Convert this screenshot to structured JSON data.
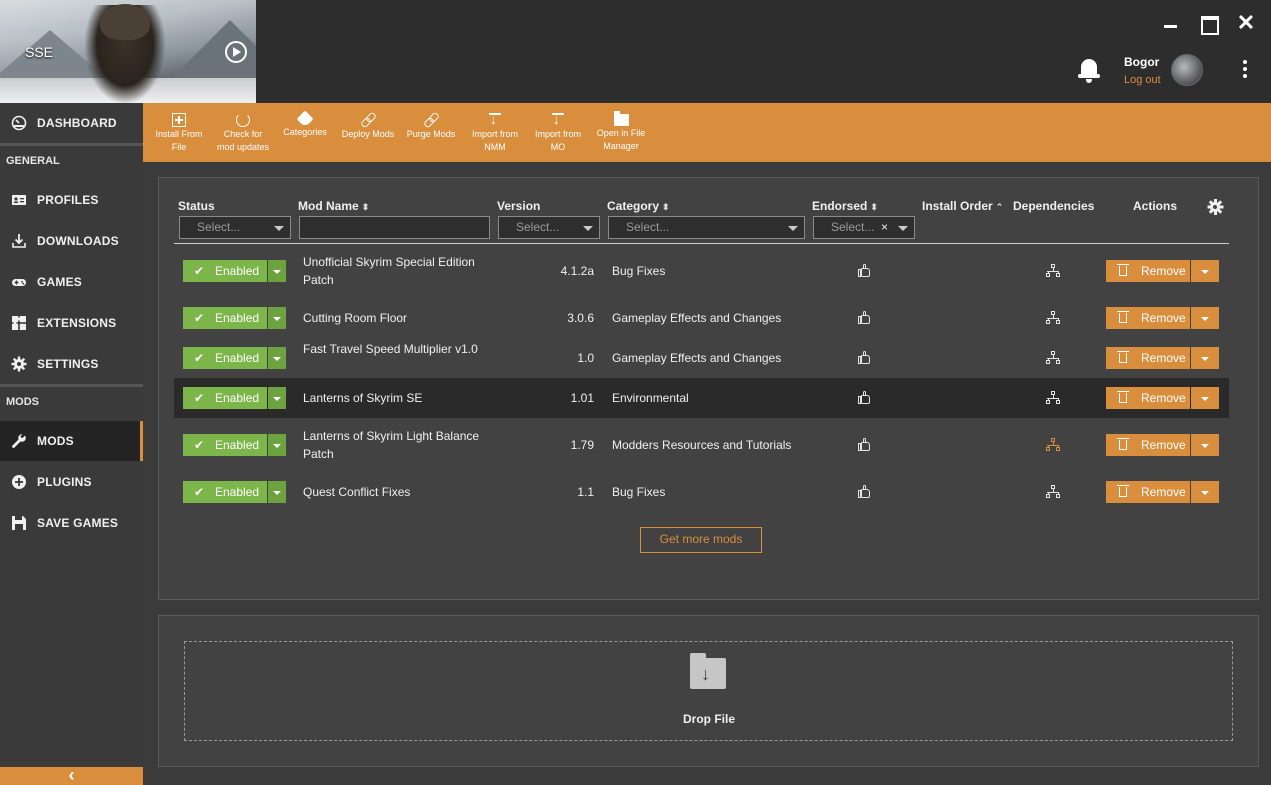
{
  "window": {
    "game_label": "SSE",
    "close_glyph": "✕"
  },
  "user": {
    "name": "Bogor",
    "logout_label": "Log out"
  },
  "sidebar": {
    "dashboard": "DASHBOARD",
    "section_general": "GENERAL",
    "profiles": "PROFILES",
    "downloads": "DOWNLOADS",
    "games": "GAMES",
    "extensions": "EXTENSIONS",
    "settings": "SETTINGS",
    "section_mods": "MODS",
    "mods": "MODS",
    "plugins": "PLUGINS",
    "save_games": "SAVE GAMES",
    "collapse_glyph": "‹",
    "active_item": "mods"
  },
  "toolbar": {
    "install_from_file": "Install From\nFile",
    "check_updates": "Check for\nmod updates",
    "categories": "Categories",
    "deploy_mods": "Deploy Mods",
    "purge_mods": "Purge Mods",
    "import_nmm": "Import from\nNMM",
    "import_mo": "Import from\nMO",
    "open_file_manager": "Open in File\nManager"
  },
  "table": {
    "headers": {
      "status": "Status",
      "mod_name": "Mod Name",
      "version": "Version",
      "category": "Category",
      "endorsed": "Endorsed",
      "install_order": "Install Order",
      "dependencies": "Dependencies",
      "actions": "Actions"
    },
    "filters": {
      "status_placeholder": "Select...",
      "mod_name_value": "",
      "version_placeholder": "Select...",
      "category_placeholder": "Select...",
      "endorsed_value": "Select...",
      "endorsed_clear": "×"
    },
    "rows": [
      {
        "status": "Enabled",
        "name": "Unofficial Skyrim Special Edition Patch",
        "version": "4.1.2a",
        "category": "Bug Fixes",
        "remove": "Remove",
        "selected": false,
        "dep_color": "#e6e6e6"
      },
      {
        "status": "Enabled",
        "name": "Cutting Room Floor",
        "version": "3.0.6",
        "category": "Gameplay Effects and Changes",
        "remove": "Remove",
        "selected": false,
        "dep_color": "#e6e6e6"
      },
      {
        "status": "Enabled",
        "name": "Fast Travel Speed Multiplier v1.0",
        "version": "1.0",
        "category": "Gameplay Effects and Changes",
        "remove": "Remove",
        "selected": false,
        "dep_color": "#e6e6e6"
      },
      {
        "status": "Enabled",
        "name": "Lanterns of Skyrim SE",
        "version": "1.01",
        "category": "Environmental",
        "remove": "Remove",
        "selected": true,
        "dep_color": "#e6e6e6"
      },
      {
        "status": "Enabled",
        "name": "Lanterns of Skyrim Light Balance Patch",
        "version": "1.79",
        "category": "Modders Resources and Tutorials",
        "remove": "Remove",
        "selected": false,
        "dep_color": "#d98e3e"
      },
      {
        "status": "Enabled",
        "name": "Quest Conflict Fixes",
        "version": "1.1",
        "category": "Bug Fixes",
        "remove": "Remove",
        "selected": false,
        "dep_color": "#e6e6e6"
      }
    ],
    "get_more_label": "Get more mods"
  },
  "drop": {
    "label": "Drop File"
  },
  "colors": {
    "accent": "#d98e3e",
    "enabled": "#7cb54a",
    "background": "#2f2f2f"
  }
}
